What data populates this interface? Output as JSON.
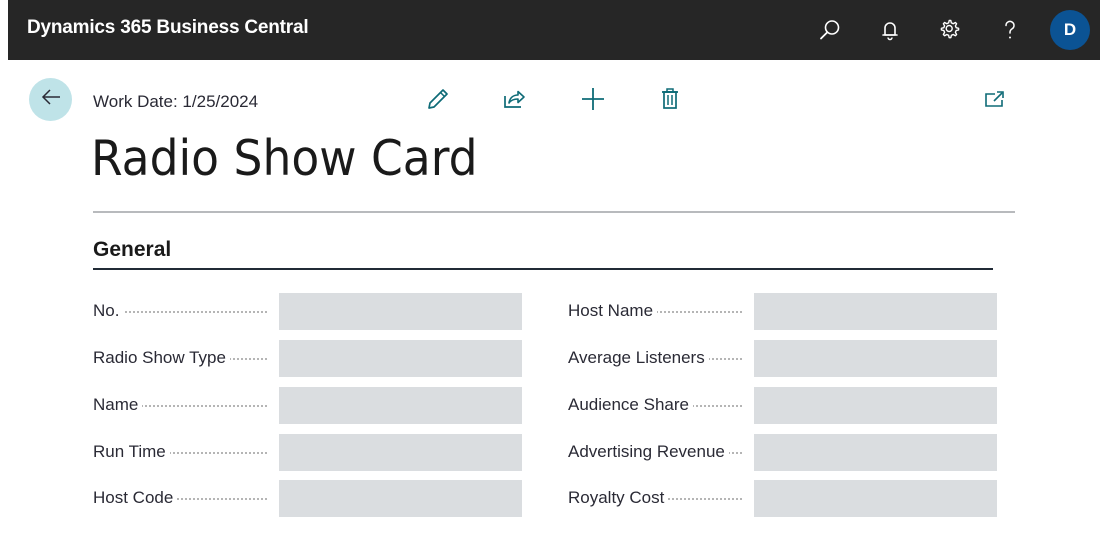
{
  "header": {
    "app_title": "Dynamics 365 Business Central",
    "icons": [
      "search-icon",
      "bell-icon",
      "gear-icon",
      "help-icon"
    ],
    "avatar_initial": "D",
    "avatar_color": "#0b5394",
    "bar_color": "#262626"
  },
  "page": {
    "work_date": "Work Date: 1/25/2024",
    "title": "Radio Show Card",
    "actions": [
      "edit-icon",
      "share-icon",
      "new-icon",
      "delete-icon"
    ],
    "accent_color": "#0e6b77"
  },
  "section": {
    "title": "General",
    "left_fields": [
      {
        "label": "No.",
        "value": ""
      },
      {
        "label": "Radio Show Type",
        "value": ""
      },
      {
        "label": "Name",
        "value": ""
      },
      {
        "label": "Run Time",
        "value": ""
      },
      {
        "label": "Host Code",
        "value": ""
      }
    ],
    "right_fields": [
      {
        "label": "Host Name",
        "value": ""
      },
      {
        "label": "Average Listeners",
        "value": ""
      },
      {
        "label": "Audience Share",
        "value": ""
      },
      {
        "label": "Advertising Revenue",
        "value": ""
      },
      {
        "label": "Royalty Cost",
        "value": ""
      }
    ]
  }
}
